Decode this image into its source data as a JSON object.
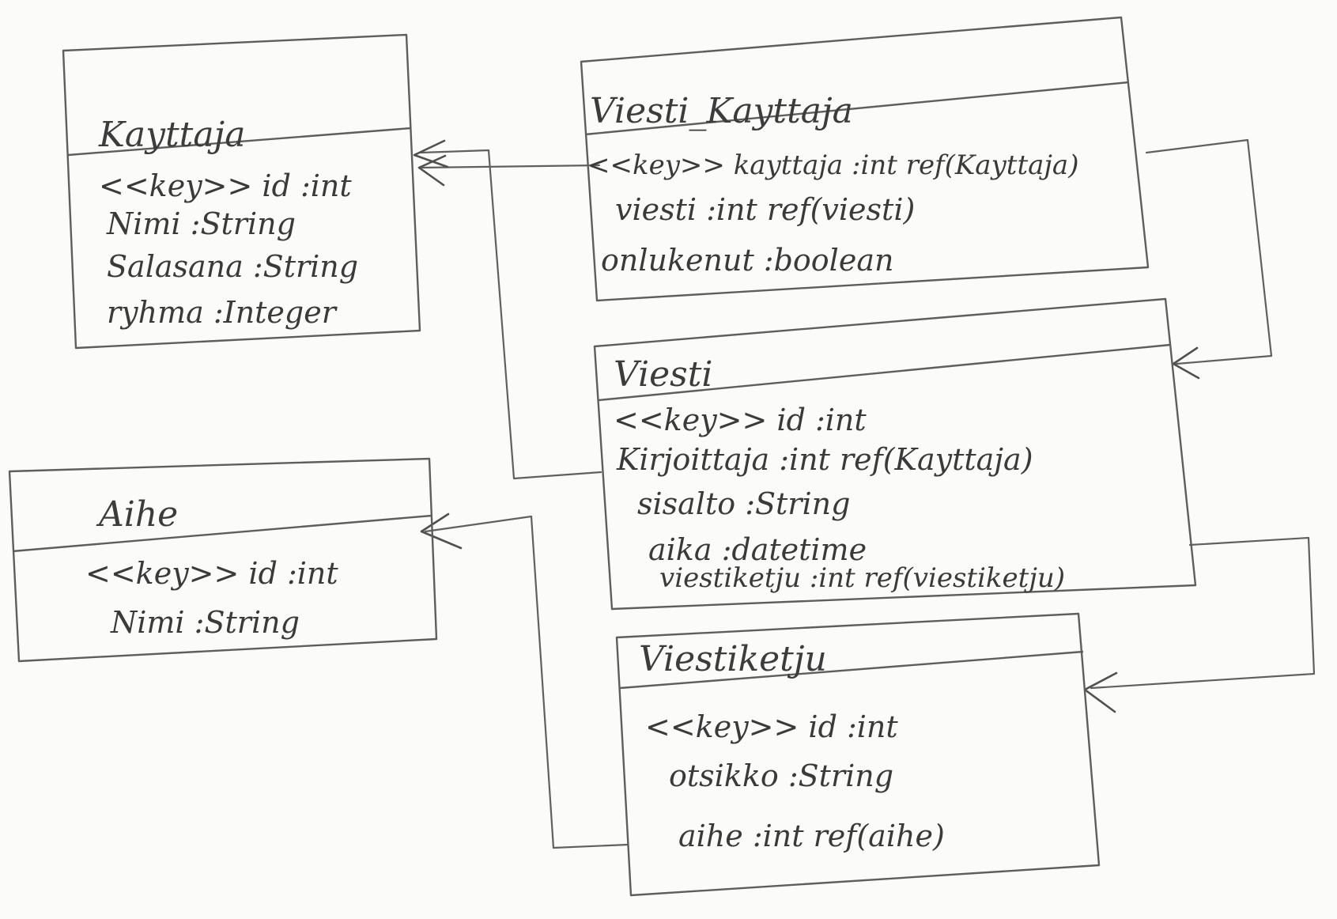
{
  "diagram": {
    "type": "uml-class-diagram",
    "classes": {
      "kayttaja": {
        "title": "Kayttaja",
        "attrs": [
          "<<key>> id :int",
          "Nimi :String",
          "Salasana :String",
          "ryhma :Integer"
        ]
      },
      "aihe": {
        "title": "Aihe",
        "attrs": [
          "<<key>> id :int",
          "Nimi :String"
        ]
      },
      "viesti_kayttaja": {
        "title": "Viesti_Kayttaja",
        "attrs": [
          "<<key>> kayttaja :int ref(Kayttaja)",
          "viesti :int   ref(viesti)",
          "onlukenut   :boolean"
        ]
      },
      "viesti": {
        "title": "Viesti",
        "attrs": [
          "<<key>> id :int",
          "Kirjoittaja :int  ref(Kayttaja)",
          "sisalto :String",
          "aika   :datetime",
          "viestiketju :int  ref(viestiketju)"
        ]
      },
      "viestiketju": {
        "title": "Viestiketju",
        "attrs": [
          "<<key>> id :int",
          "otsikko :String",
          "aihe :int   ref(aihe)"
        ]
      }
    },
    "relations": [
      {
        "from": "Viesti_Kayttaja",
        "to": "Kayttaja"
      },
      {
        "from": "Viesti",
        "to": "Kayttaja"
      },
      {
        "from": "Viesti_Kayttaja",
        "to": "Viesti"
      },
      {
        "from": "Viesti",
        "to": "Viestiketju"
      },
      {
        "from": "Viestiketju",
        "to": "Aihe"
      }
    ]
  }
}
